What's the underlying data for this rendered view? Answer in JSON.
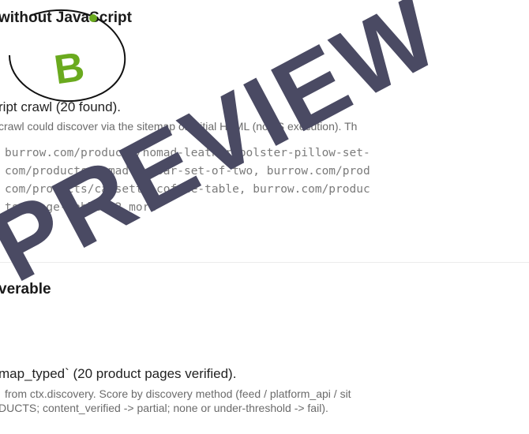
{
  "section1": {
    "title": "without JavaScript",
    "grade": "B",
    "summary": "ript crawl (20 found).",
    "detail": "crawl could discover via the sitemap or initial HTML (no JS execution). Th",
    "urls": [
      "burrow.com/products/nomad-leather-bolster-pillow-set-",
      "com/products/nomad-lumbar-set-of-two, burrow.com/prod",
      "com/products/cassette-coffee-table, burrow.com/produc",
      "ts/range-table +2 more"
    ]
  },
  "section2": {
    "title": "verable",
    "summary": "map_typed` (20 product pages verified).",
    "detail_lines": [
      "from ctx.discovery. Score by discovery method (feed / platform_api / sit",
      "DUCTS; content_verified -> partial; none or under-threshold -> fail)."
    ]
  },
  "colors": {
    "badge_green": "#6aaa1e",
    "watermark": "#4a4a63"
  },
  "watermark": "PREVIEW"
}
